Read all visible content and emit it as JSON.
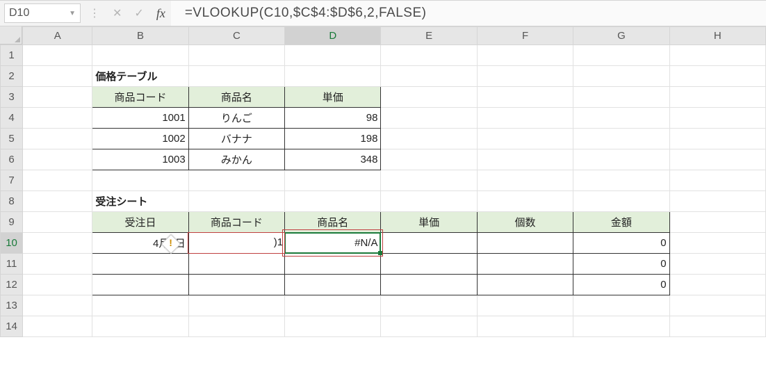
{
  "name_box": {
    "value": "D10"
  },
  "formula_bar": {
    "text": "=VLOOKUP(C10,$C$4:$D$6,2,FALSE)"
  },
  "columns": [
    "A",
    "B",
    "C",
    "D",
    "E",
    "F",
    "G",
    "H"
  ],
  "rows": [
    "1",
    "2",
    "3",
    "4",
    "5",
    "6",
    "7",
    "8",
    "9",
    "10",
    "11",
    "12",
    "13",
    "14"
  ],
  "section1_title": "価格テーブル",
  "table1": {
    "headers": [
      "商品コード",
      "商品名",
      "単価"
    ],
    "rows": [
      {
        "code": "1001",
        "name": "りんご",
        "price": "98"
      },
      {
        "code": "1002",
        "name": "バナナ",
        "price": "198"
      },
      {
        "code": "1003",
        "name": "みかん",
        "price": "348"
      }
    ]
  },
  "section2_title": "受注シート",
  "table2": {
    "headers": [
      "受注日",
      "商品コード",
      "商品名",
      "単価",
      "個数",
      "金額"
    ],
    "rows": [
      {
        "date": "4月1日",
        "code_trunc": ")1",
        "name": "#N/A",
        "price": "",
        "qty": "",
        "amount": "0"
      },
      {
        "date": "",
        "code_trunc": "",
        "name": "",
        "price": "",
        "qty": "",
        "amount": "0"
      },
      {
        "date": "",
        "code_trunc": "",
        "name": "",
        "price": "",
        "qty": "",
        "amount": "0"
      }
    ]
  },
  "icons": {
    "dropdown": "dropdown-icon",
    "vdots": "vertical-dots-icon",
    "cancel": "cancel-icon",
    "enter": "enter-icon",
    "fx": "fx-icon",
    "error": "error-indicator-icon"
  }
}
